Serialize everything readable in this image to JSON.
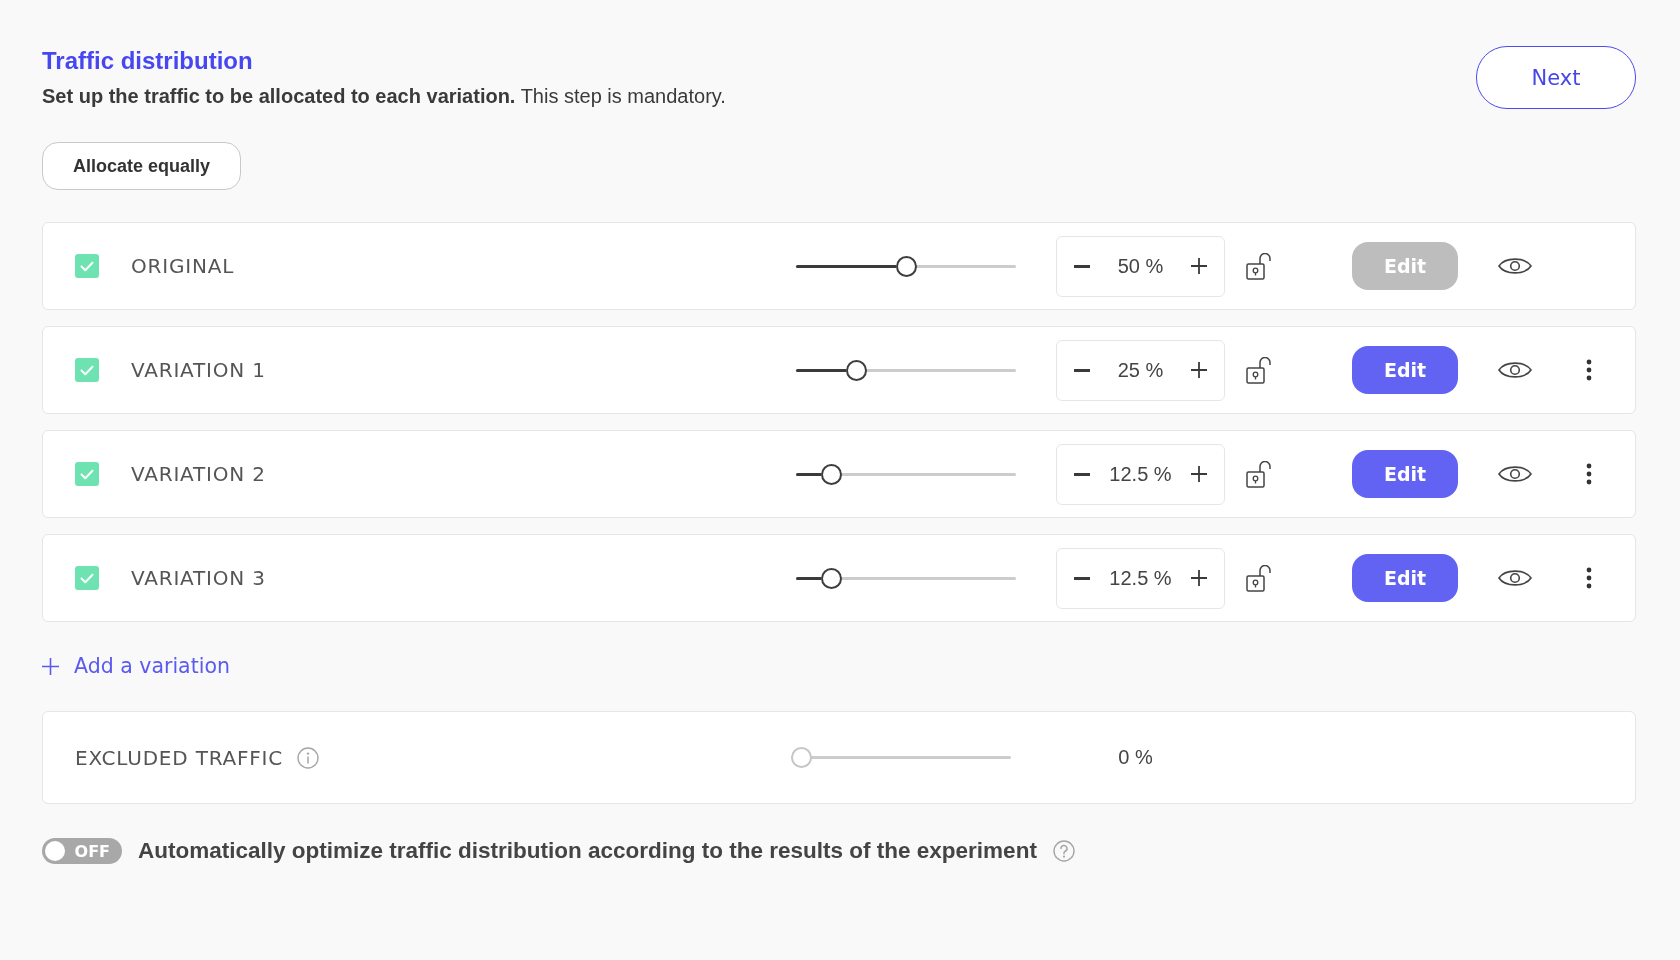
{
  "header": {
    "title": "Traffic distribution",
    "subtitle": "**Set up the traffic to be allocated to each variation.** This step is mandatory.",
    "next_button": "Next"
  },
  "allocate_button": "Allocate equally",
  "variations": [
    {
      "name": "ORIGINAL",
      "checked": true,
      "level": 0.5,
      "value": "50 %",
      "locked": false,
      "edit": {
        "label": "Edit",
        "disabled": true
      },
      "has_menu": false
    },
    {
      "name": "VARIATION 1",
      "checked": true,
      "level": 0.25,
      "value": "25 %",
      "locked": false,
      "edit": {
        "label": "Edit",
        "disabled": false
      },
      "has_menu": true
    },
    {
      "name": "VARIATION 2",
      "checked": true,
      "level": 0.125,
      "value": "12.5 %",
      "locked": false,
      "edit": {
        "label": "Edit",
        "disabled": false
      },
      "has_menu": true
    },
    {
      "name": "VARIATION 3",
      "checked": true,
      "level": 0.125,
      "value": "12.5 %",
      "locked": false,
      "edit": {
        "label": "Edit",
        "disabled": false
      },
      "has_menu": true
    }
  ],
  "add_variation": "Add a variation",
  "excluded_traffic": {
    "label": "EXCLUDED TRAFFIC",
    "level": 0,
    "value": "0 %",
    "disabled": true
  },
  "auto_optimize": {
    "on": false,
    "switch_label": "OFF",
    "label": "Automatically optimize traffic distribution according to the results of the experiment"
  }
}
